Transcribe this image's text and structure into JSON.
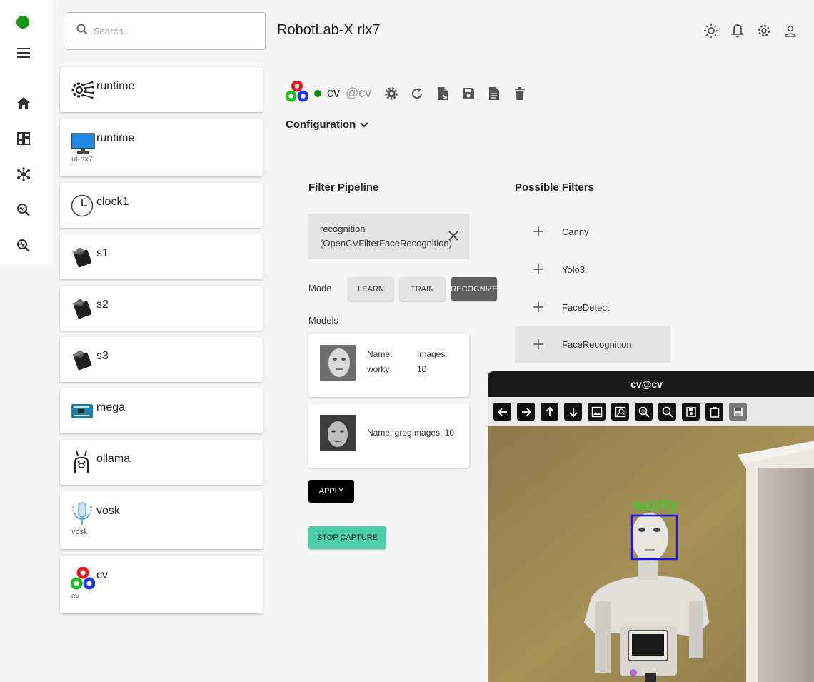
{
  "header": {
    "search_placeholder": "Search...",
    "title": "RobotLab-X rlx7",
    "icons": [
      "theme-icon",
      "bell-icon",
      "gear-icon",
      "account-icon"
    ]
  },
  "rail": {
    "status_color": "#119911",
    "icons": [
      "menu-icon",
      "home-icon",
      "dashboard-icon",
      "network-icon",
      "search-analytics-icon",
      "search-analytics-icon"
    ]
  },
  "services": [
    {
      "name": "runtime",
      "sub": "",
      "icon": "gear-wires-icon"
    },
    {
      "name": "runtime",
      "sub": "ui-rlx7",
      "icon": "monitor-icon"
    },
    {
      "name": "clock1",
      "sub": "",
      "icon": "clock-icon"
    },
    {
      "name": "s1",
      "sub": "",
      "icon": "servo-icon"
    },
    {
      "name": "s2",
      "sub": "",
      "icon": "servo-icon"
    },
    {
      "name": "s3",
      "sub": "",
      "icon": "servo-icon"
    },
    {
      "name": "mega",
      "sub": "",
      "icon": "arduino-icon"
    },
    {
      "name": "ollama",
      "sub": "",
      "icon": "llama-icon"
    },
    {
      "name": "vosk",
      "sub": "vosk",
      "icon": "microphone-icon"
    },
    {
      "name": "cv",
      "sub": "cv",
      "icon": "opencv-icon"
    }
  ],
  "service": {
    "name": "cv",
    "id": "@cv",
    "status_color": "#118811",
    "config_label": "Configuration"
  },
  "pipeline": {
    "title": "Filter Pipeline",
    "filter_line1": "recognition",
    "filter_line2": "(OpenCVFilterFaceRecognition)",
    "mode_label": "Mode",
    "learn": "LEARN",
    "train": "TRAIN",
    "recognize": "RECOGNIZE",
    "active_mode": "RECOGNIZE",
    "models_label": "Models",
    "models": [
      {
        "name_label": "Name:",
        "name": "worky",
        "images_label": "Images:",
        "images": "10"
      },
      {
        "text": "Name: grogImages: 10"
      }
    ],
    "apply": "APPLY",
    "stop": "STOP CAPTURE"
  },
  "possible": {
    "title": "Possible Filters",
    "items": [
      "Canny",
      "Yolo3",
      "FaceDetect",
      "FaceRecognition"
    ],
    "hovered": "FaceRecognition"
  },
  "video": {
    "title": "cv@cv",
    "label": "worky",
    "label_color": "#22dd22",
    "box_color": "#1a1aee"
  }
}
